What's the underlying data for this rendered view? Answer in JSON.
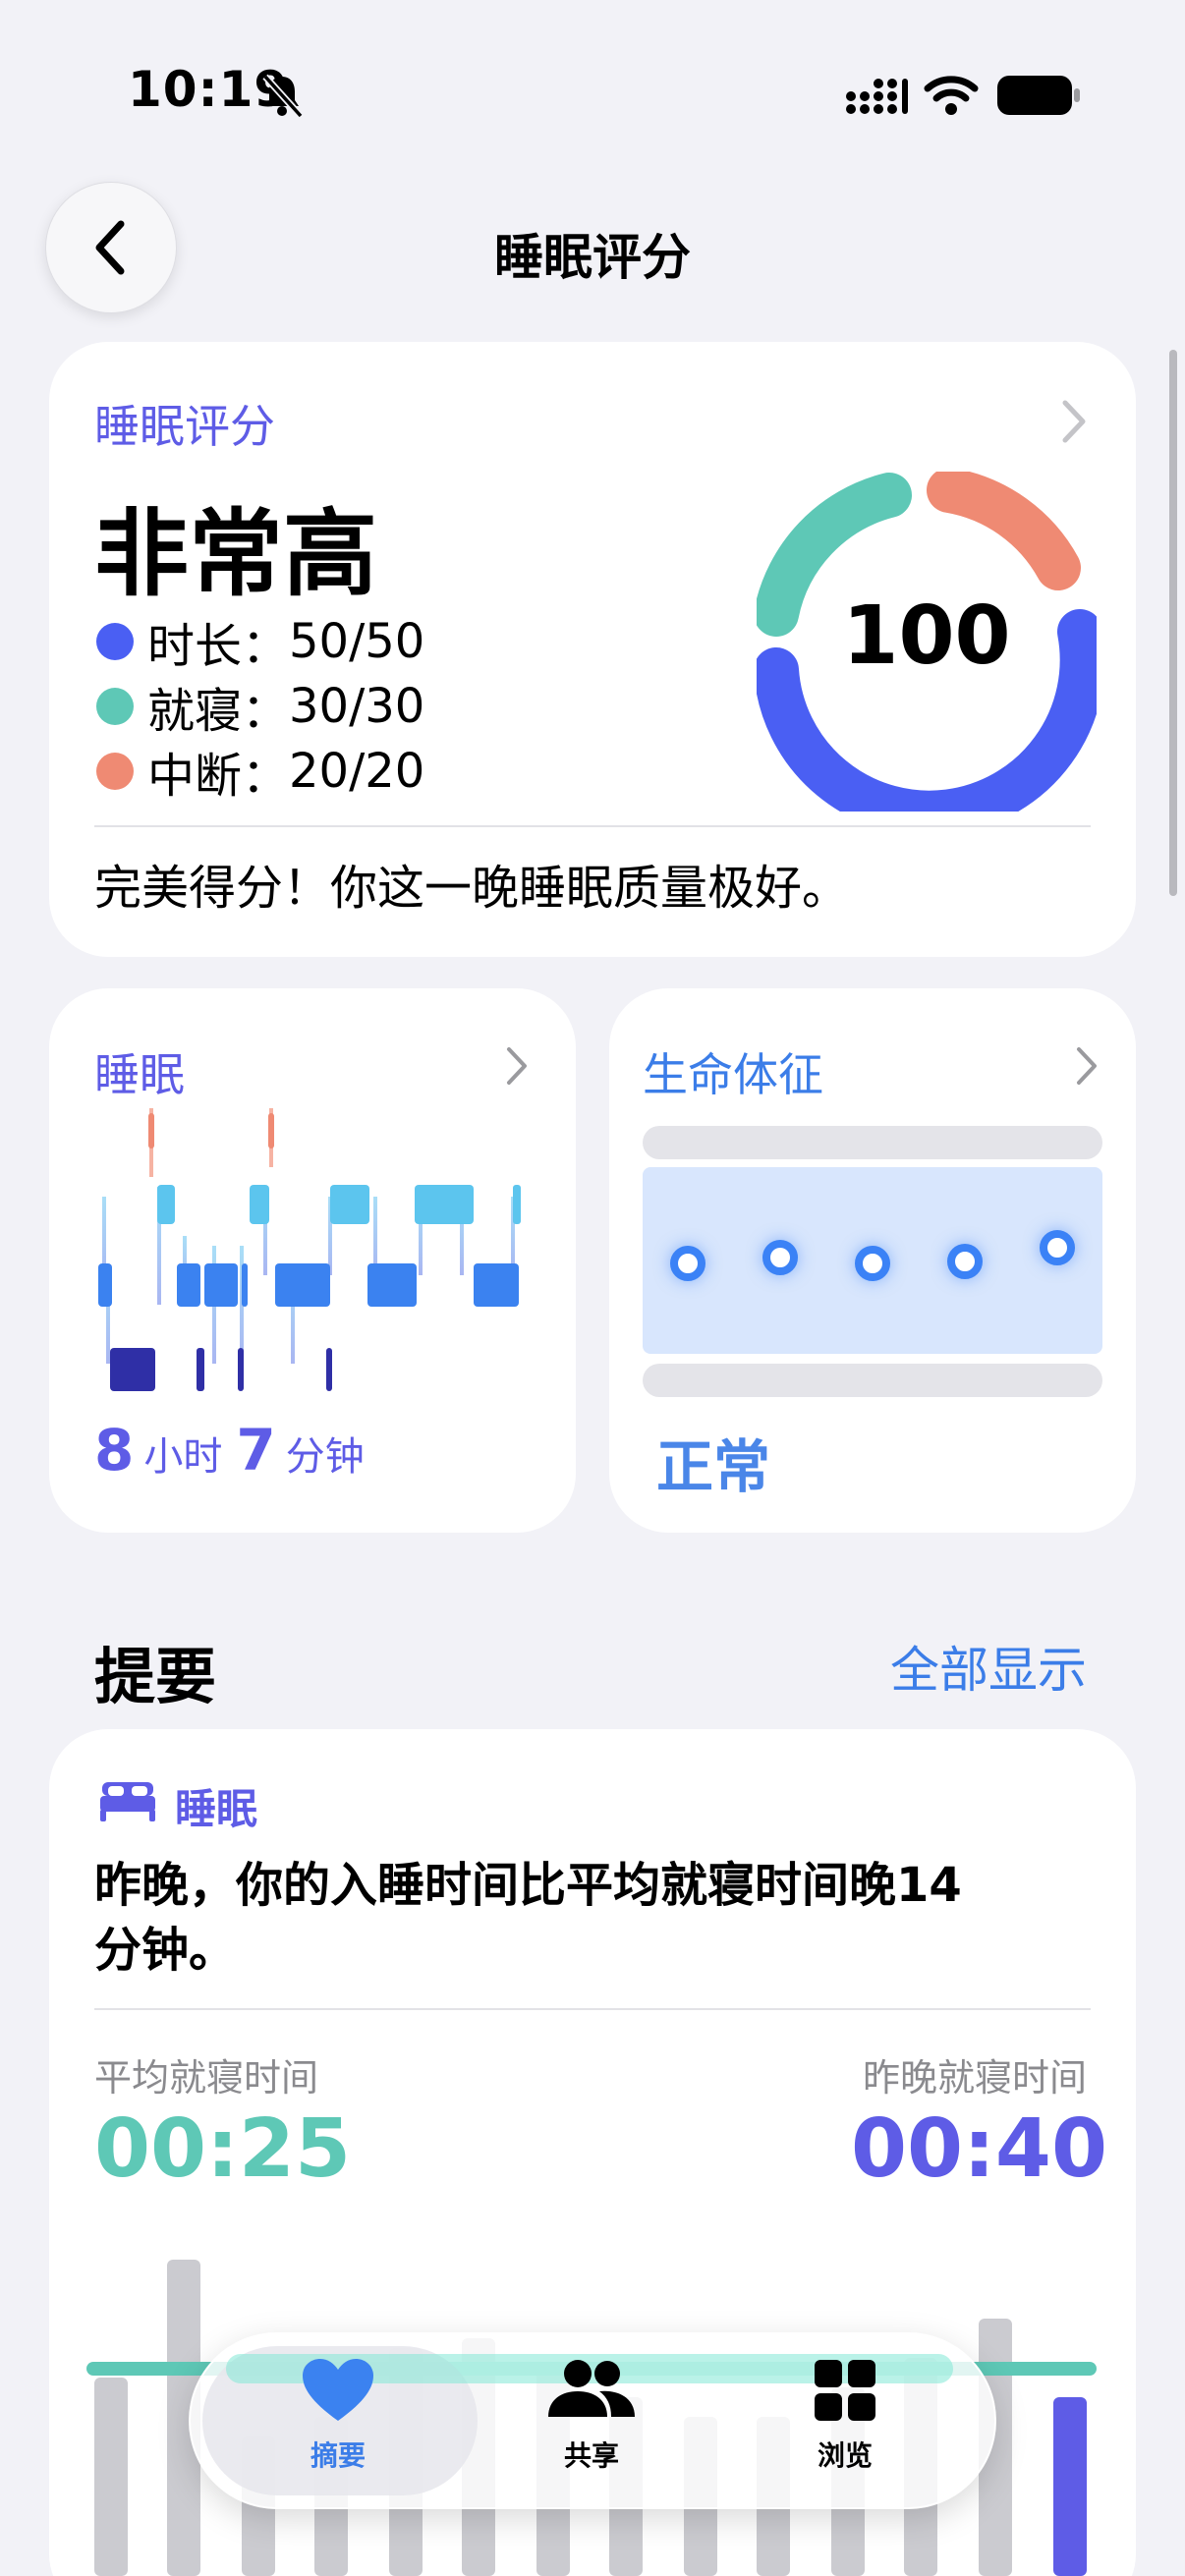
{
  "status_bar": {
    "time": "10:19"
  },
  "nav": {
    "title": "睡眠评分"
  },
  "score_card": {
    "label": "睡眠评分",
    "level": "非常高",
    "score": "100",
    "items": [
      {
        "name": "时长：",
        "value": "50/50",
        "color": "#4a5ff3"
      },
      {
        "name": "就寝：",
        "value": "30/30",
        "color": "#5ec8b6"
      },
      {
        "name": "中断：",
        "value": "20/20",
        "color": "#ef8a73"
      }
    ],
    "summary": "完美得分！你这一晚睡眠质量极好。"
  },
  "sleep_card": {
    "label": "睡眠",
    "hours": "8",
    "hours_unit": "小时",
    "minutes": "7",
    "minutes_unit": "分钟"
  },
  "vitals_card": {
    "label": "生命体征",
    "status": "正常"
  },
  "highlights": {
    "title": "提要",
    "show_all": "全部显示",
    "card": {
      "category": "睡眠",
      "text": "昨晚，你的入睡时间比平均就寝时间晚14 分钟。",
      "avg_label": "平均就寝时间",
      "avg_value": "00:25",
      "last_label": "昨晚就寝时间",
      "last_value": "00:40"
    }
  },
  "tabs": [
    {
      "label": "摘要",
      "icon": "heart-icon",
      "active": true
    },
    {
      "label": "共享",
      "icon": "people-icon",
      "active": false
    },
    {
      "label": "浏览",
      "icon": "grid-icon",
      "active": false
    }
  ],
  "colors": {
    "accent_purple": "#5e5ce6",
    "accent_blue": "#3b7de8",
    "teal": "#5ec8b6",
    "coral": "#ef8a73",
    "indigo": "#4a5ff3"
  }
}
